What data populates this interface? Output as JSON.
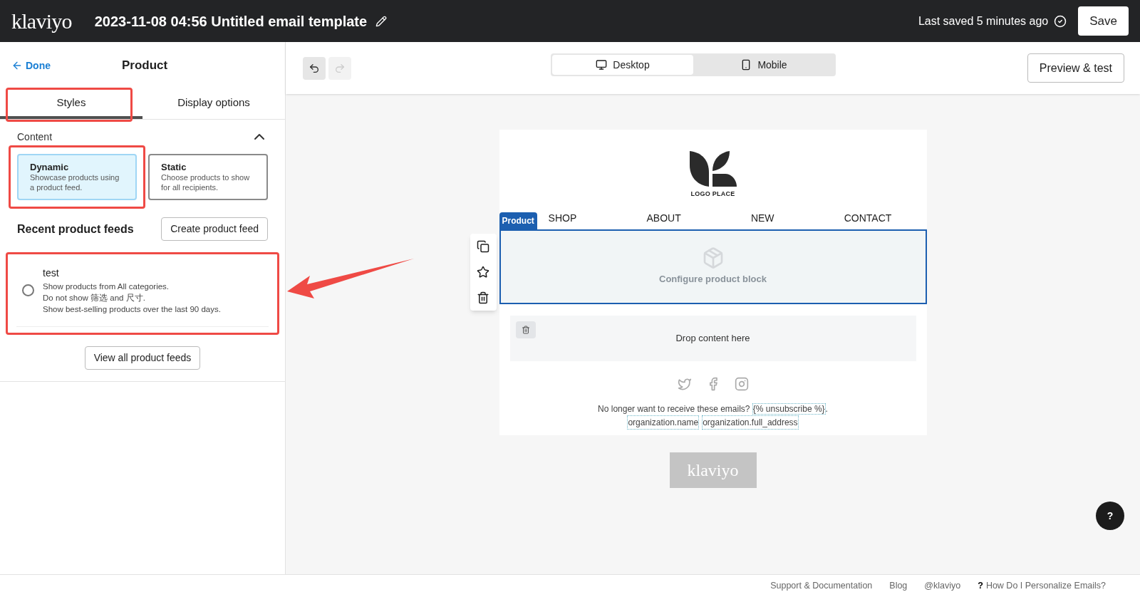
{
  "header": {
    "logo": "klaviyo",
    "title": "2023-11-08 04:56 Untitled email template",
    "save_status": "Last saved 5 minutes ago",
    "save_button": "Save"
  },
  "sidebar": {
    "back": "Done",
    "title": "Product",
    "tabs": [
      {
        "label": "Styles",
        "selected": true
      },
      {
        "label": "Display options",
        "selected": false
      }
    ],
    "section": {
      "title": "Content",
      "expanded": true
    },
    "content_options": [
      {
        "title": "Dynamic",
        "description": "Showcase products using a product feed.",
        "selected": true
      },
      {
        "title": "Static",
        "description": "Choose products to show for all recipients.",
        "selected": false
      }
    ],
    "feeds_heading": "Recent product feeds",
    "create_button": "Create product feed",
    "feeds": [
      {
        "name": "test",
        "lines": [
          "Show products from All categories.",
          "Do not show 筛选 and 尺寸.",
          "Show best-selling products over the last 90 days."
        ],
        "selected": false
      }
    ],
    "view_all_button": "View all product feeds"
  },
  "toolbar": {
    "undo_enabled": true,
    "redo_enabled": false,
    "devices": [
      {
        "label": "Desktop",
        "kind": "desktop",
        "selected": true
      },
      {
        "label": "Mobile",
        "kind": "mobile",
        "selected": false
      }
    ],
    "preview_button": "Preview & test"
  },
  "email": {
    "logo_text": "LOGO PLACE",
    "nav": [
      "SHOP",
      "ABOUT",
      "NEW",
      "CONTACT"
    ],
    "block_tag": "Product",
    "block_text": "Configure product block",
    "drop_text": "Drop content here",
    "unsubscribe_text": "No longer want to receive these emails?",
    "unsubscribe_tag": "{% unsubscribe %}",
    "unsubscribe_end": ".",
    "address_tags": [
      "organization.name",
      "organization.full_address"
    ],
    "footer_logo": "klaviyo"
  },
  "help_button": "?",
  "footer_links": [
    {
      "label": "Support & Documentation",
      "kind": "link"
    },
    {
      "label": "Blog",
      "kind": "link"
    },
    {
      "label": "@klaviyo",
      "kind": "link"
    },
    {
      "label": "How Do I Personalize Emails?",
      "kind": "help",
      "icon_text": "?"
    }
  ]
}
